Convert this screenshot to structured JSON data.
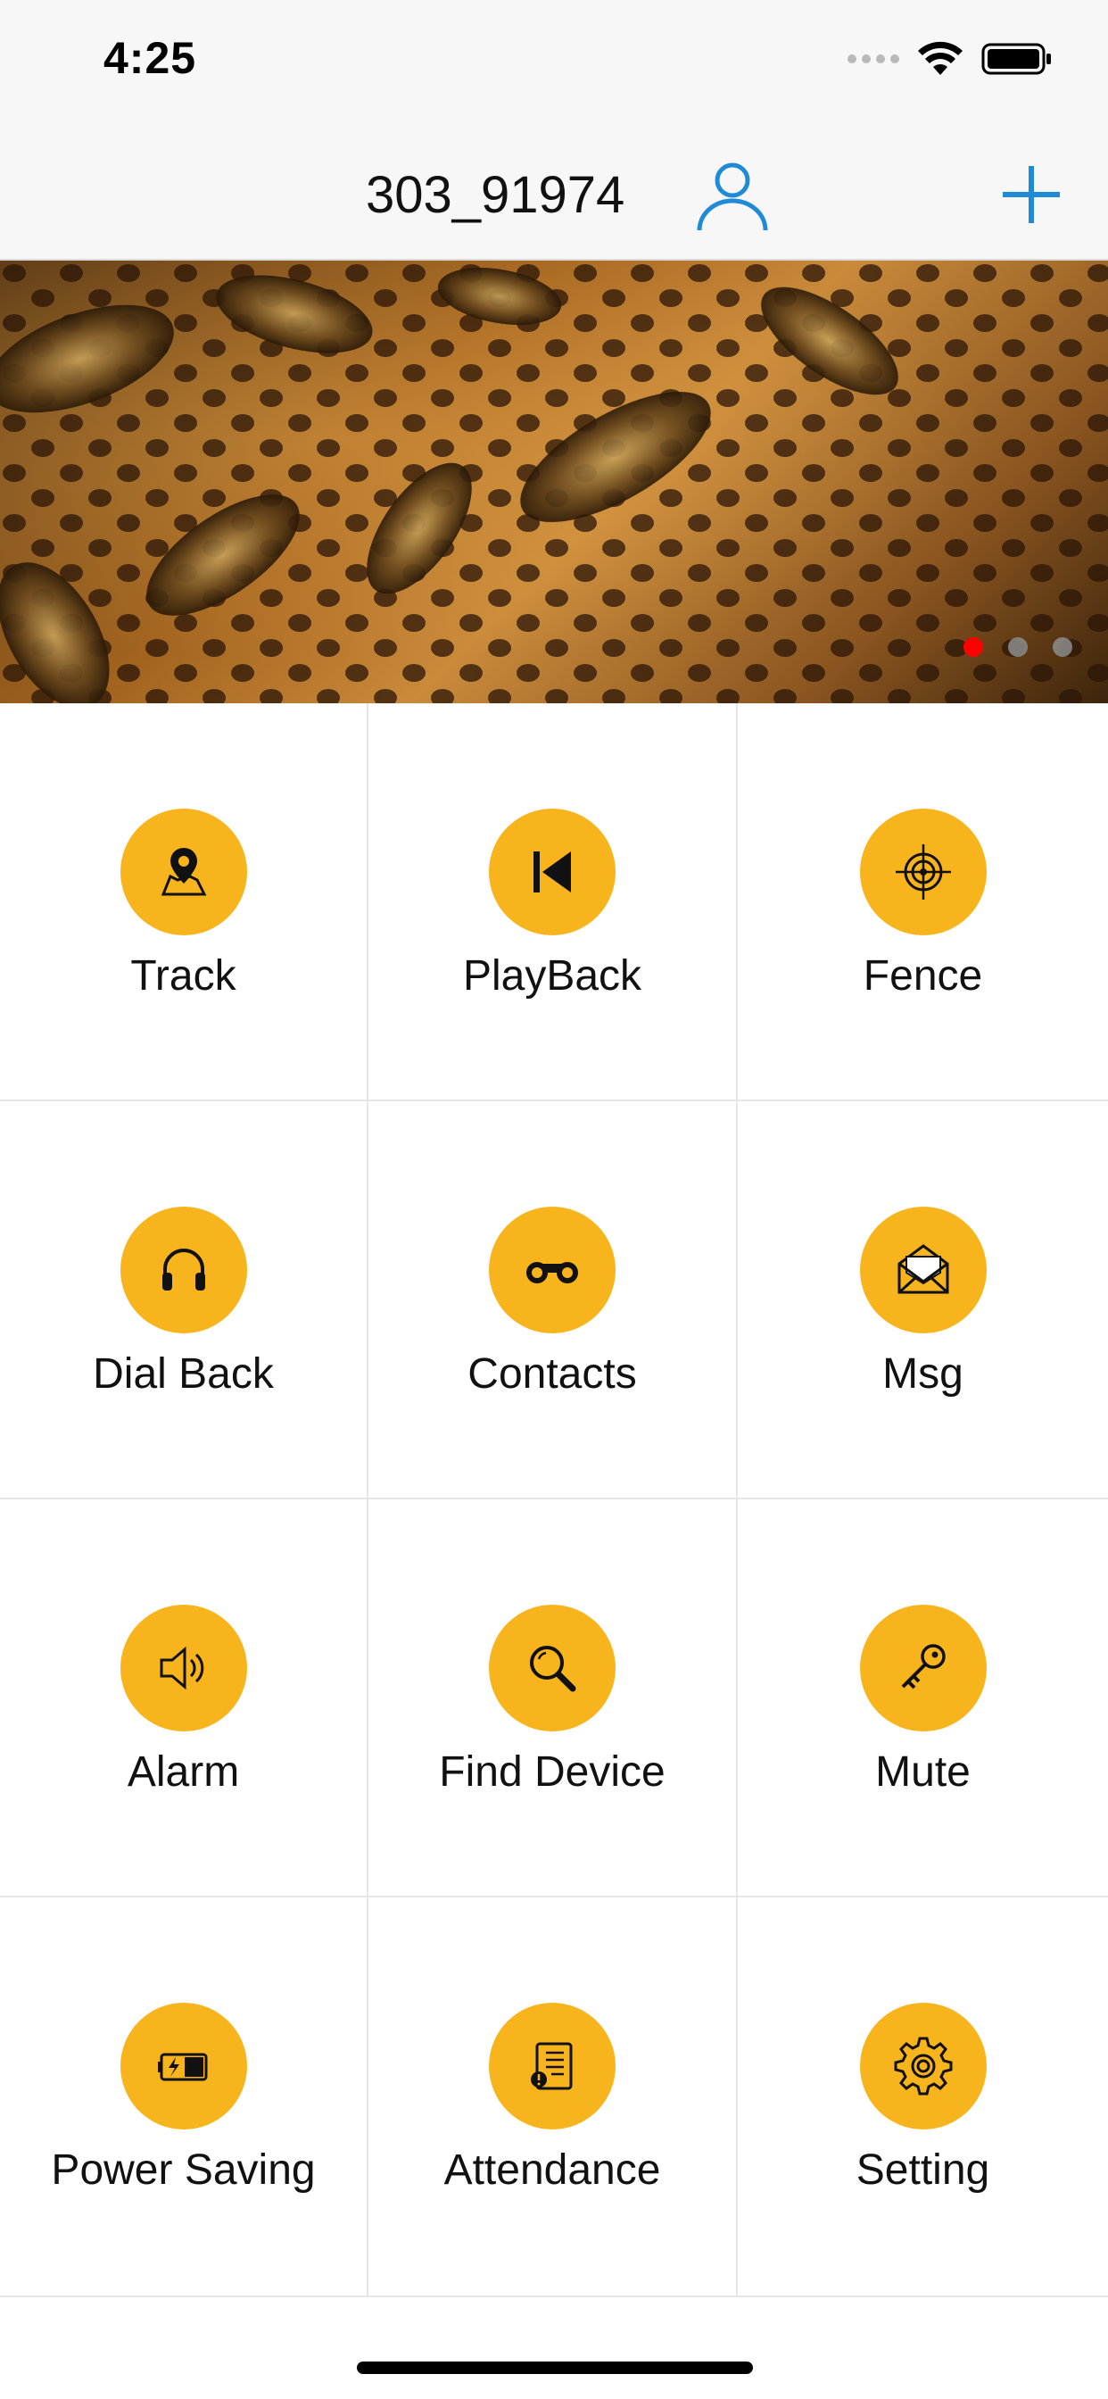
{
  "status_bar": {
    "time": "4:25"
  },
  "nav": {
    "title": "303_91974",
    "accent_color": "#1f8ad6"
  },
  "banner": {
    "page_count": 3,
    "active_page": 1
  },
  "theme": {
    "icon_background": "#f8b41c",
    "pager_active": "#ff0000"
  },
  "menu": [
    {
      "label": "Track",
      "icon": "map-pin-icon"
    },
    {
      "label": "PlayBack",
      "icon": "skip-back-icon"
    },
    {
      "label": "Fence",
      "icon": "crosshair-icon"
    },
    {
      "label": "Dial Back",
      "icon": "headphones-icon"
    },
    {
      "label": "Contacts",
      "icon": "binoculars-icon"
    },
    {
      "label": "Msg",
      "icon": "envelope-icon"
    },
    {
      "label": "Alarm",
      "icon": "speaker-icon"
    },
    {
      "label": "Find Device",
      "icon": "magnifier-icon"
    },
    {
      "label": "Mute",
      "icon": "key-icon"
    },
    {
      "label": "Power Saving",
      "icon": "battery-icon"
    },
    {
      "label": "Attendance",
      "icon": "clipboard-icon"
    },
    {
      "label": "Setting",
      "icon": "gear-icon"
    }
  ]
}
